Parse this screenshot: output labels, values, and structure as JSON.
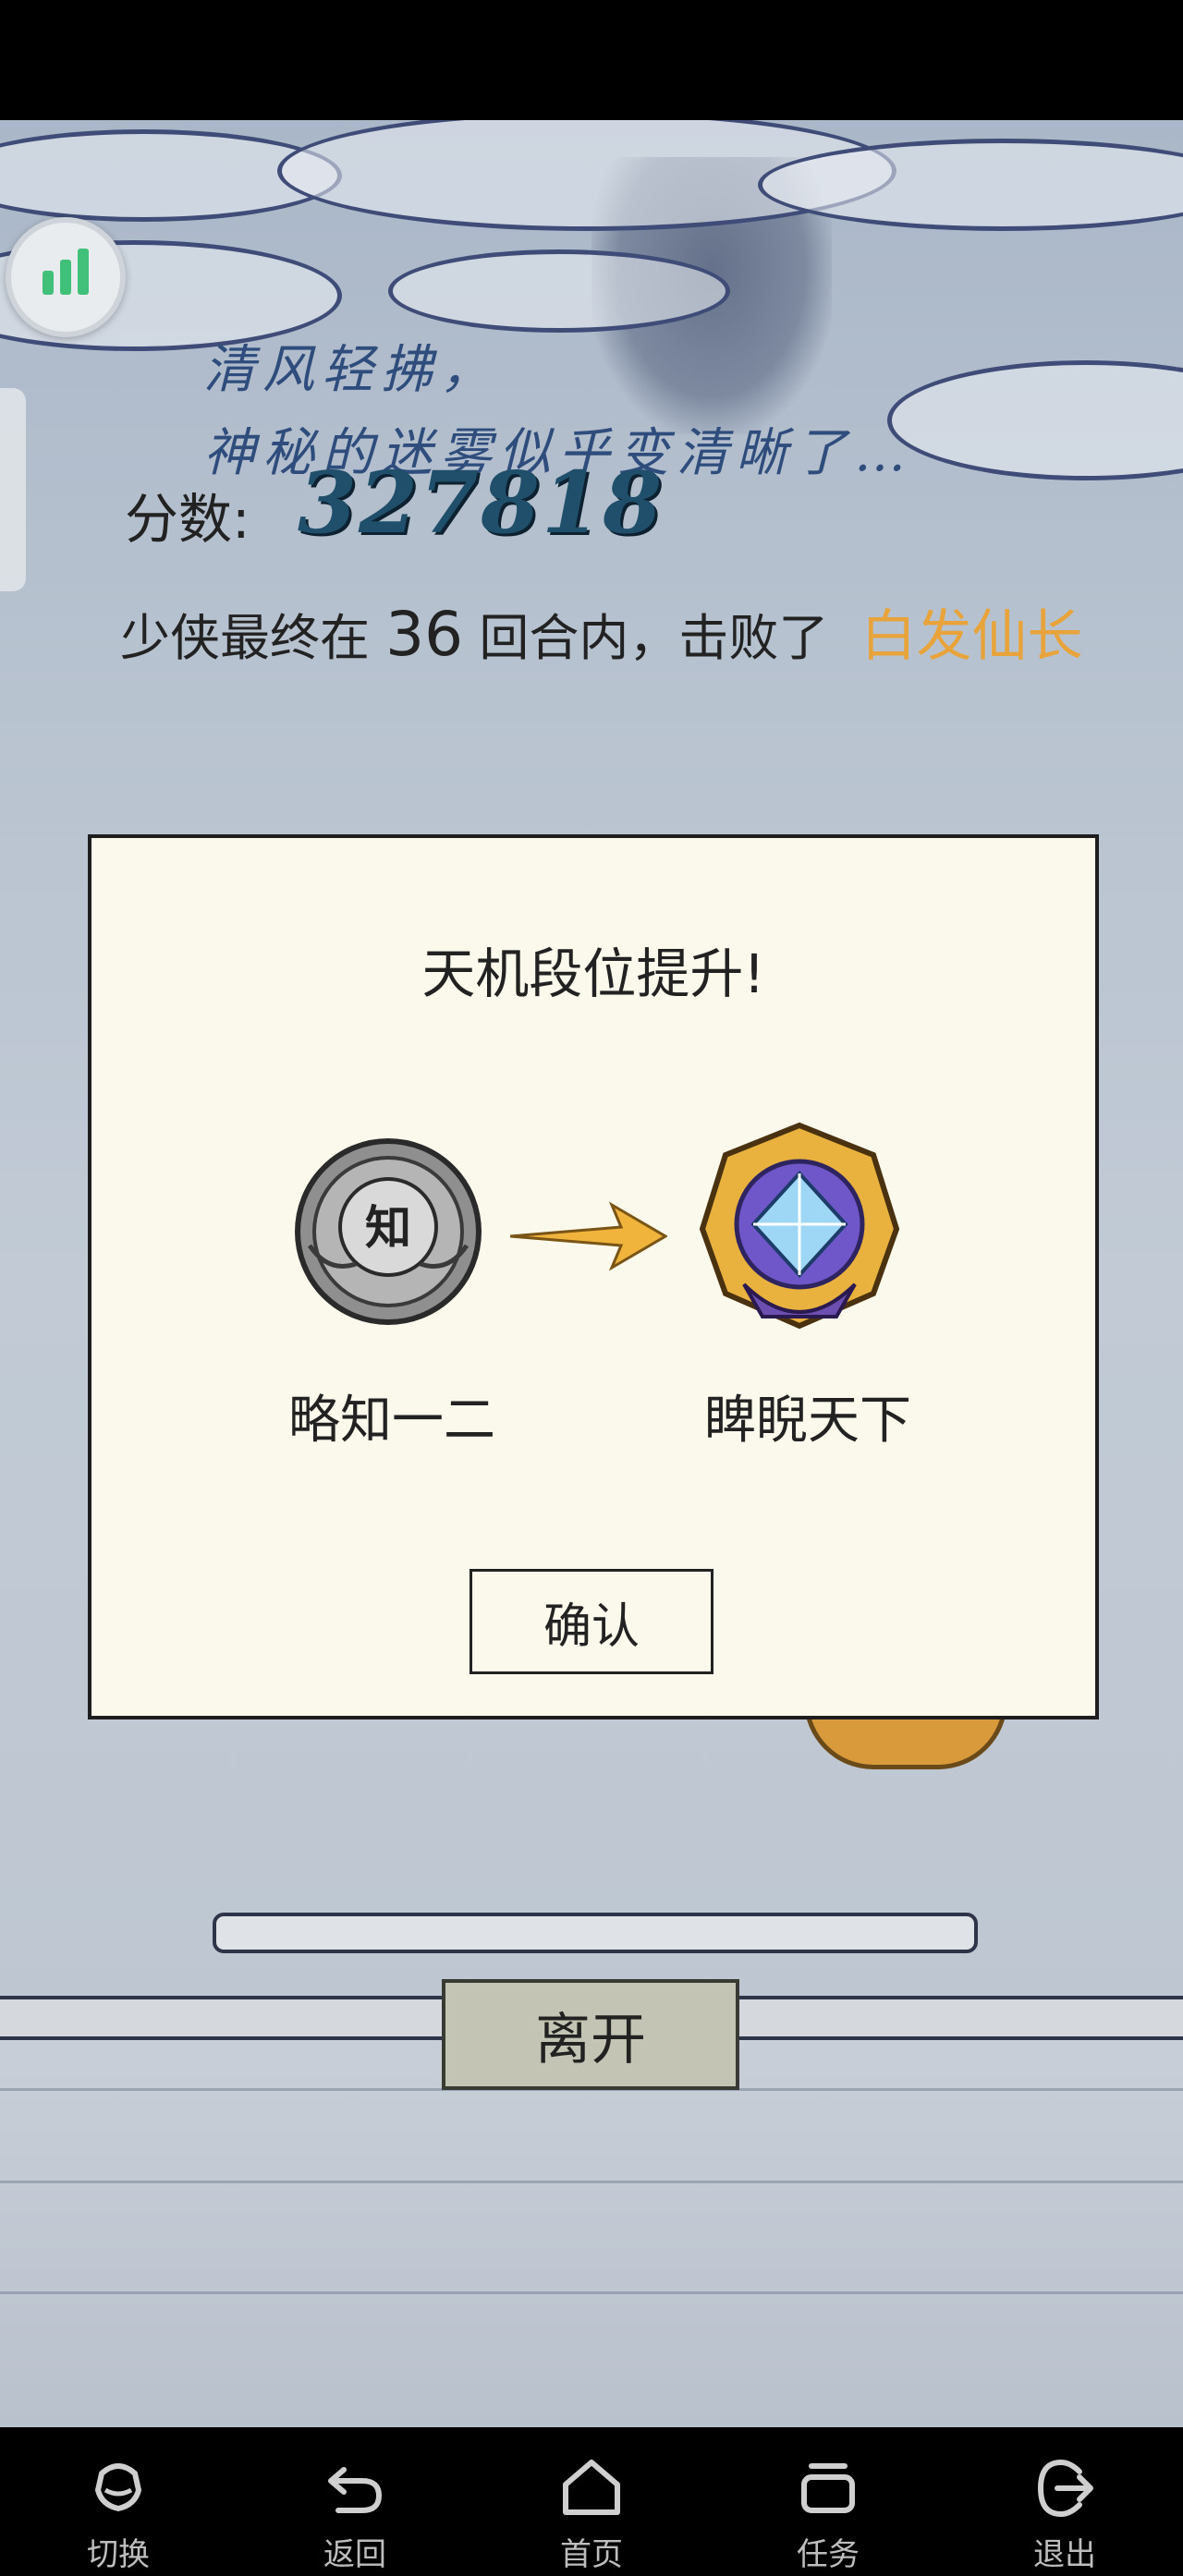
{
  "poem": {
    "line1": "清风轻拂，",
    "line2": "神秘的迷雾似乎变清晰了…"
  },
  "score": {
    "label": "分数:",
    "value": "327818"
  },
  "result": {
    "prefix": "少侠最终在",
    "rounds": "36",
    "middle": "回合内，击败了",
    "boss": "白发仙长"
  },
  "dialog": {
    "title": "天机段位提升!",
    "old_rank": {
      "icon_char": "知",
      "label": "略知一二"
    },
    "new_rank": {
      "label": "睥睨天下"
    },
    "confirm_label": "确认"
  },
  "leave_label": "离开",
  "navbar": {
    "items": [
      {
        "label": "切换",
        "icon": "switch-icon"
      },
      {
        "label": "返回",
        "icon": "back-icon"
      },
      {
        "label": "首页",
        "icon": "home-icon"
      },
      {
        "label": "任务",
        "icon": "tasks-icon"
      },
      {
        "label": "退出",
        "icon": "exit-icon"
      }
    ]
  },
  "colors": {
    "boss_name": "#e8a43a",
    "score": "#1f4f6a",
    "dialog_bg": "#fbf8ec",
    "float_button_bars": "#41c07a"
  }
}
